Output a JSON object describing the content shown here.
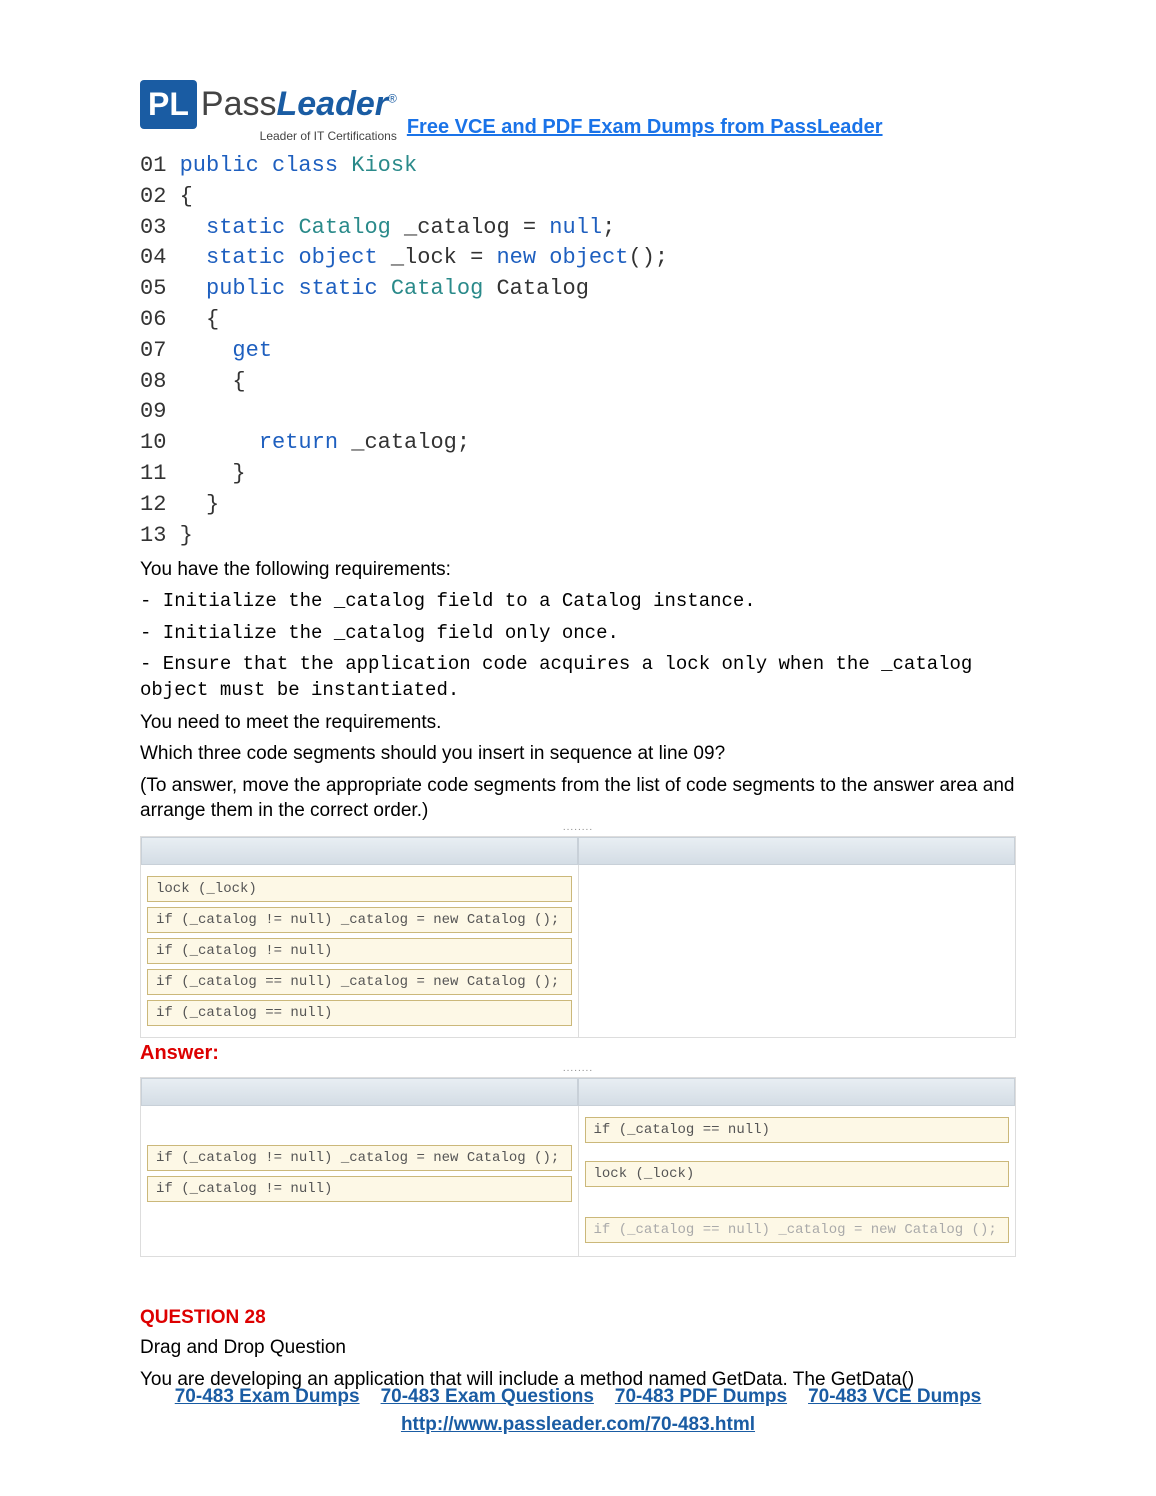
{
  "header": {
    "logo_initials": "PL",
    "logo_main": "Pass",
    "logo_main2": "Leader",
    "logo_reg": "®",
    "logo_sub": "Leader of IT Certifications",
    "top_link": "Free VCE and PDF Exam Dumps from PassLeader"
  },
  "code": {
    "l01_a": "01 ",
    "l01_kw1": "public",
    "l01_b": " ",
    "l01_kw2": "class",
    "l01_c": " ",
    "l01_cls": "Kiosk",
    "l02": "02 {",
    "l03_a": "03   ",
    "l03_kw": "static",
    "l03_b": " ",
    "l03_cls": "Catalog",
    "l03_c": " _catalog = ",
    "l03_kw2": "null",
    "l03_d": ";",
    "l04_a": "04   ",
    "l04_kw": "static",
    "l04_b": " ",
    "l04_kw2": "object",
    "l04_c": " _lock = ",
    "l04_kw3": "new",
    "l04_d": " ",
    "l04_kw4": "object",
    "l04_e": "();",
    "l05_a": "05   ",
    "l05_kw1": "public",
    "l05_b": " ",
    "l05_kw2": "static",
    "l05_c": " ",
    "l05_cls": "Catalog",
    "l05_d": " Catalog",
    "l06": "06   {",
    "l07_a": "07     ",
    "l07_kw": "get",
    "l08": "08     {",
    "l09": "09",
    "l10_a": "10       ",
    "l10_kw": "return",
    "l10_b": " _catalog;",
    "l11": "11     }",
    "l12": "12   }",
    "l13": "13 }"
  },
  "desc": {
    "req_heading": "You have the following requirements:",
    "req1": "- Initialize the _catalog field to a Catalog instance.",
    "req2": "- Initialize the _catalog field only once.",
    "req3": "- Ensure that the application code acquires a lock only when the _catalog object must be instantiated.",
    "need": "You need to meet the requirements.",
    "which": "Which three code segments should you insert in sequence at line 09?",
    "instr": "(To answer, move the appropriate code segments from the list of code segments to the answer area and arrange them in the correct order.)"
  },
  "segments_q_left": [
    "lock (_lock)",
    "if (_catalog != null) _catalog = new Catalog ();",
    "if (_catalog != null)",
    "if (_catalog == null) _catalog = new Catalog ();",
    "if (_catalog == null)"
  ],
  "answer_label": "Answer:",
  "segments_a_left": [
    "if (_catalog != null) _catalog = new Catalog ();",
    "if (_catalog != null)"
  ],
  "segments_a_right": [
    "if (_catalog == null)",
    "lock (_lock)",
    "if (_catalog == null) _catalog = new Catalog ();"
  ],
  "q28": {
    "heading": "QUESTION 28",
    "type": "Drag and Drop Question",
    "text": "You are developing an application that will include a method named GetData. The GetData()"
  },
  "footer": {
    "l1": "70-483 Exam Dumps",
    "l2": "70-483 Exam Questions",
    "l3": "70-483 PDF Dumps",
    "l4": "70-483 VCE Dumps",
    "url": "http://www.passleader.com/70-483.html"
  }
}
